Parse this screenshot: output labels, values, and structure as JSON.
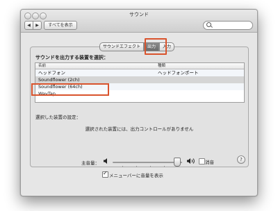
{
  "window": {
    "title": "サウンド",
    "show_all_label": "すべてを表示",
    "back_label": "◀",
    "forward_label": "▶"
  },
  "tabs": [
    {
      "label": "サウンドエフェクト",
      "active": false
    },
    {
      "label": "出力",
      "active": true
    },
    {
      "label": "入力",
      "active": false
    }
  ],
  "output": {
    "device_prompt": "サウンドを出力する装置を選択：",
    "columns": {
      "name": "名前",
      "type": "種類"
    },
    "devices": [
      {
        "name": "ヘッドフォン",
        "type": "ヘッドフォンポート",
        "selected": false
      },
      {
        "name": "Soundflower (2ch)",
        "type": "",
        "selected": true
      },
      {
        "name": "Soundflower (64ch)",
        "type": "",
        "selected": false
      },
      {
        "name": "WavTap",
        "type": "",
        "selected": false
      }
    ],
    "settings_label": "選択した装置の設定：",
    "no_controls_message": "選択された装置には、出力コントロールがありません",
    "help_label": "?"
  },
  "volume": {
    "label": "主音量：",
    "level": 0.93,
    "mute_label": "消音",
    "muted": false,
    "menu_bar_label": "メニューバーに音量を表示",
    "menu_bar_checked": true
  },
  "colors": {
    "highlight": "#d9532c",
    "selected_row": "#d5d5d5",
    "active_tab": "#7a7a7a"
  }
}
